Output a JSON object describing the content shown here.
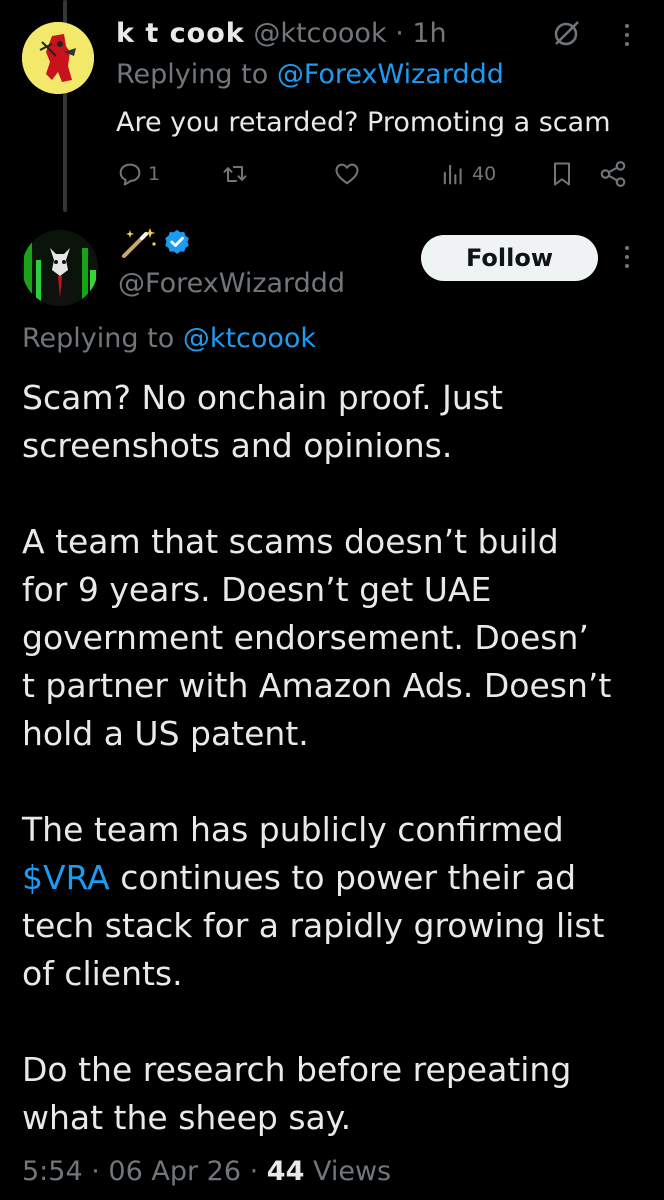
{
  "reply": {
    "name": "k t cook",
    "handle": "@ktcoook",
    "separator": "·",
    "time": "1h",
    "replying_prefix": "Replying to",
    "replying_to": "@ForexWizarddd",
    "text": "Are you retarded? Promoting a scam",
    "reply_count": "1",
    "views_count": "40"
  },
  "tweet": {
    "handle": "@ForexWizarddd",
    "follow_label": "Follow",
    "replying_prefix": "Replying to",
    "replying_to": "@ktcoook",
    "p1_l1": "Scam? No onchain proof. Just",
    "p1_l2": "screenshots and opinions.",
    "p2_l1": "A team that scams doesn’t build",
    "p2_l2": "for 9 years. Doesn’t get UAE",
    "p2_l3": "government endorsement. Doesn’",
    "p2_l4": "t partner with Amazon Ads. Doesn’t",
    "p2_l5": "hold a US patent.",
    "p3_l1": "The team has publicly confirmed",
    "p3_cashtag": "$VRA",
    "p3_l2_rest": " continues to power their ad",
    "p3_l3": "tech stack for a rapidly growing list",
    "p3_l4": "of clients.",
    "p4_l1": "Do the research before repeating",
    "p4_l2": "what the sheep say.",
    "time": "5:54",
    "separator": "·",
    "date": "06 Apr 26",
    "views": "44",
    "views_label": "Views"
  },
  "icons": {
    "reply_icon": "speech-bubble",
    "retweet_icon": "retweet-arrows",
    "like_icon": "heart",
    "views_icon": "bar-chart",
    "bookmark_icon": "bookmark",
    "share_icon": "share-nodes",
    "grok_icon": "slashed-circle",
    "verified_icon": "blue-check-badge",
    "name_emoji": "magic-wand"
  },
  "colors": {
    "background": "#000000",
    "text": "#e7e9ea",
    "secondary": "#71767b",
    "link": "#1d9bf0",
    "follow_bg": "#eff3f4"
  }
}
